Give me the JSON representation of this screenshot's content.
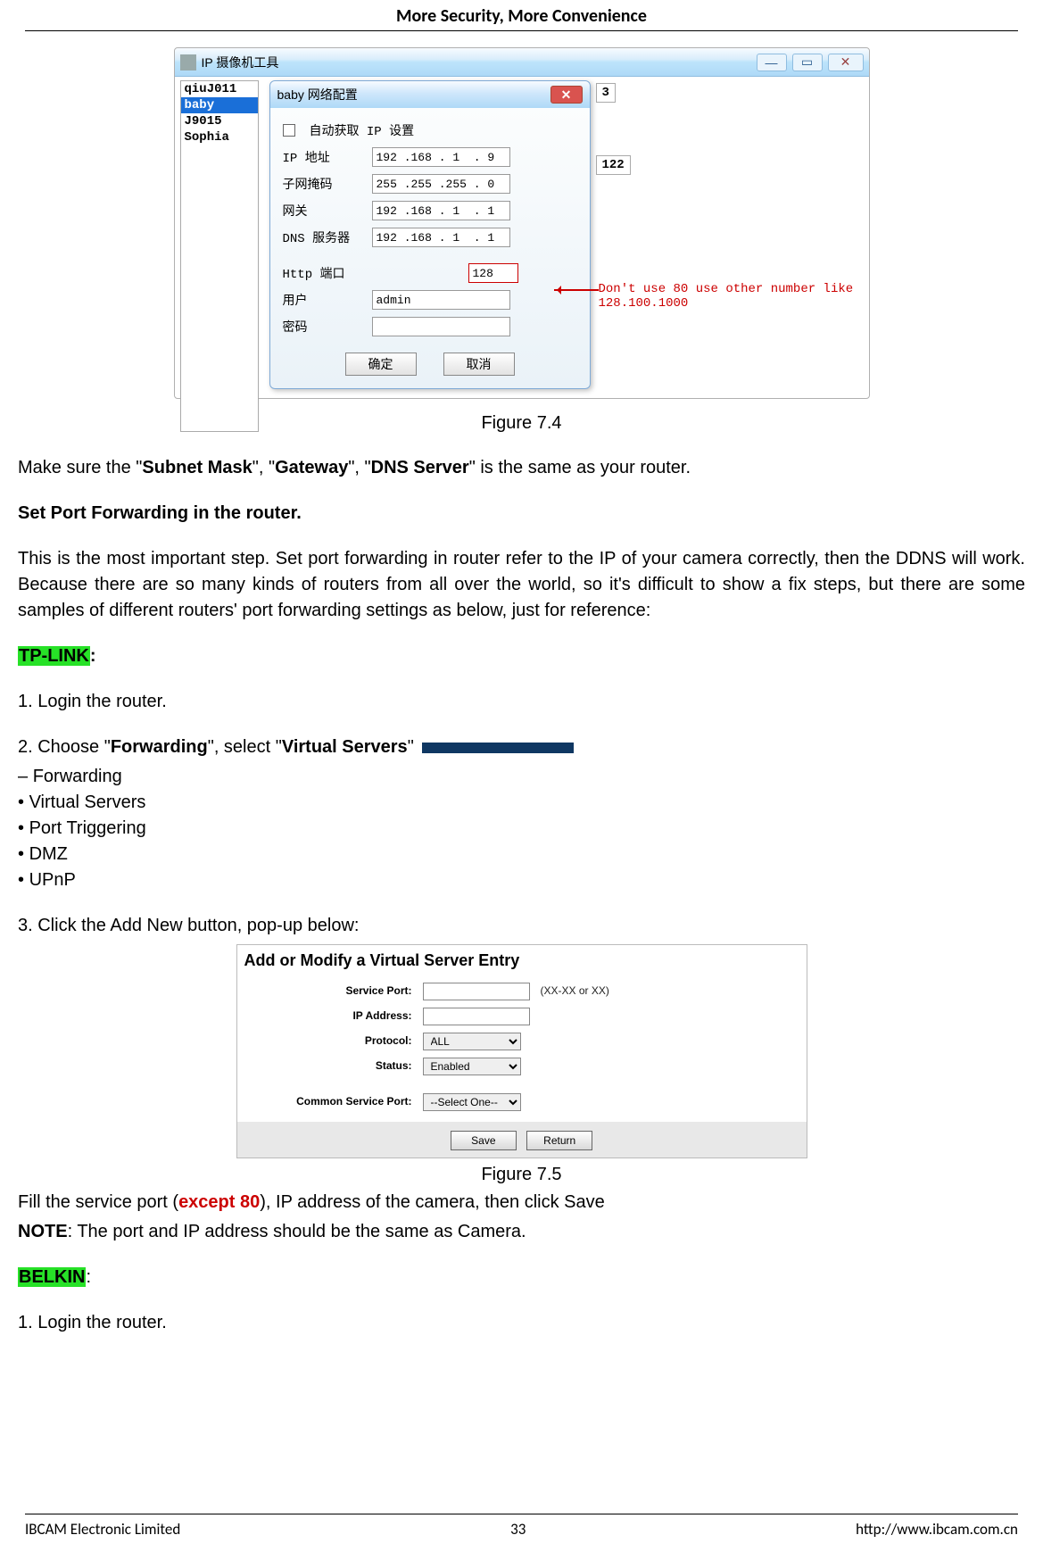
{
  "header": {
    "title": "More Security, More Convenience"
  },
  "win74": {
    "title": "IP 摄像机工具",
    "devices": [
      "qiuJ011",
      "baby",
      "J9015",
      "Sophia"
    ],
    "selected_index": 1,
    "bg_field1": "3",
    "bg_field2": "122",
    "annotation": "Don't use 80 use other number like\n128.100.1000"
  },
  "dlg74": {
    "title": "baby 网络配置",
    "auto_chk_label": "自动获取 IP 设置",
    "rows": {
      "ip": {
        "label": "IP 地址",
        "value": "192 .168 . 1  . 9"
      },
      "mask": {
        "label": "子网掩码",
        "value": "255 .255 .255 . 0"
      },
      "gateway": {
        "label": "网关",
        "value": "192 .168 . 1  . 1"
      },
      "dns": {
        "label": "DNS 服务器",
        "value": "192 .168 . 1  . 1"
      },
      "port": {
        "label": "Http 端口",
        "value": "128"
      },
      "user": {
        "label": "用户",
        "value": "admin"
      },
      "pass": {
        "label": "密码",
        "value": ""
      }
    },
    "ok": "确定",
    "cancel": "取消"
  },
  "cap74": "Figure 7.4",
  "t": {
    "p1_a": "Make sure the \"",
    "p1_b": "Subnet Mask",
    "p1_c": "\", \"",
    "p1_d": "Gateway",
    "p1_e": "\", \"",
    "p1_f": "DNS Server",
    "p1_g": "\" is the same as your router.",
    "h1": "Set Port Forwarding in the router.",
    "p2": "This is the most important step. Set port forwarding in router refer to the IP of your camera correctly, then the DDNS will work. Because there are so many kinds of routers from all over the world, so it's difficult to show a fix steps, but there are some samples of different routers' port forwarding settings as below, just for reference:",
    "tplink": "TP-LINK",
    "colon": ":",
    "s1": "1. Login the router.",
    "s2_a": "2. Choose \"",
    "s2_b": "Forwarding",
    "s2_c": "\", select \"",
    "s2_d": "Virtual Servers",
    "s2_e": "\"",
    "s3": "3. Click the Add New button, pop-up below:",
    "fill_a": "Fill the service port (",
    "fill_b": "except 80",
    "fill_c": "), IP address of the camera, then click Save",
    "note_a": "NOTE",
    "note_b": ": The port and IP address should be the same as Camera.",
    "belkin": "BELKIN",
    "s4": "1. Login the router."
  },
  "fwdmenu": {
    "header": "Forwarding",
    "items": [
      "Virtual Servers",
      "Port Triggering",
      "DMZ",
      "UPnP"
    ]
  },
  "cap75": "Figure 7.5",
  "vs": {
    "title": "Add or Modify a Virtual Server Entry",
    "service_port": "Service Port:",
    "service_hint": "(XX-XX or XX)",
    "ip": "IP Address:",
    "protocol": "Protocol:",
    "protocol_val": "ALL",
    "status": "Status:",
    "status_val": "Enabled",
    "common": "Common Service Port:",
    "common_val": "--Select One--",
    "save": "Save",
    "return": "Return"
  },
  "footer": {
    "left": "IBCAM Electronic Limited",
    "page": "33",
    "right": "http://www.ibcam.com.cn"
  }
}
